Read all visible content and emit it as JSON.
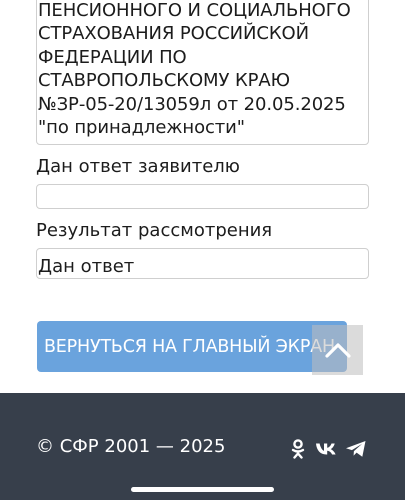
{
  "appeal": {
    "text": "ПЕНСИОННОГО И СОЦИАЛЬНОГО\nСТРАХОВАНИЯ РОССИЙСКОЙ\nФЕДЕРАЦИИ ПО\nСТАВРОПОЛЬСКОМУ КРАЮ\n№ЗР-05-20/13059л от 20.05.2025\n\"по принадлежности\""
  },
  "answer_field": {
    "label": "Дан ответ заявителю",
    "value": ""
  },
  "result_field": {
    "label": "Результат рассмотрения",
    "value": "Дан ответ"
  },
  "main_button": {
    "label": "ВЕРНУТЬСЯ НА ГЛАВНЫЙ ЭКРАН"
  },
  "footer": {
    "copyright": "© СФР 2001 — 2025",
    "social_icons": [
      "odnoklassniki-icon",
      "vk-icon",
      "telegram-icon"
    ]
  },
  "colors": {
    "button": "#6aa3dd",
    "footer_bg": "#373f4b"
  }
}
